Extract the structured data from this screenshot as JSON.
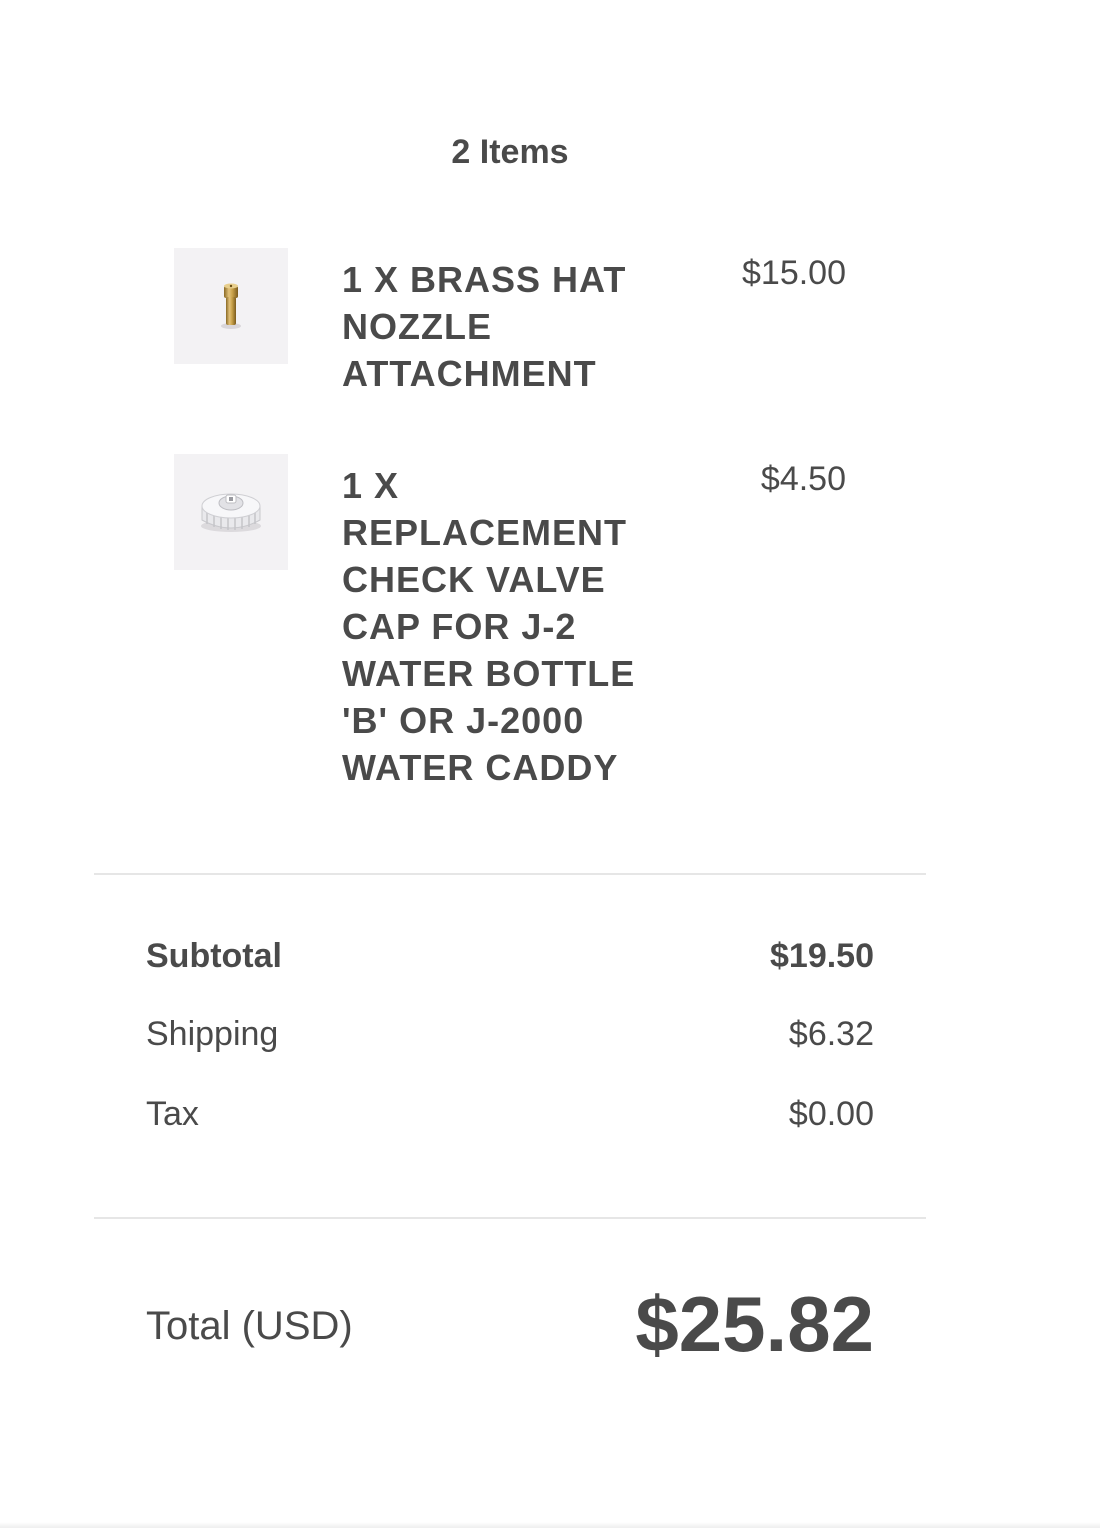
{
  "cart": {
    "items_count": "2 Items",
    "items": [
      {
        "title": "1 X BRASS HAT NOZZLE ATTACHMENT",
        "price": "$15.00",
        "image": "brass-nozzle-image"
      },
      {
        "title": "1 X REPLACEMENT CHECK VALVE CAP FOR J-2 WATER BOTTLE 'B' OR J-2000 WATER CADDY",
        "price": "$4.50",
        "image": "check-valve-cap-image"
      }
    ]
  },
  "summary": {
    "subtotal_label": "Subtotal",
    "subtotal_value": "$19.50",
    "shipping_label": "Shipping",
    "shipping_value": "$6.32",
    "tax_label": "Tax",
    "tax_value": "$0.00",
    "total_label": "Total (USD)",
    "total_value": "$25.82"
  },
  "colors": {
    "text": "#4a4a4a",
    "divider": "#e6e6e6",
    "thumbnail_bg": "#f3f2f4",
    "brass": "#c9a24a"
  }
}
